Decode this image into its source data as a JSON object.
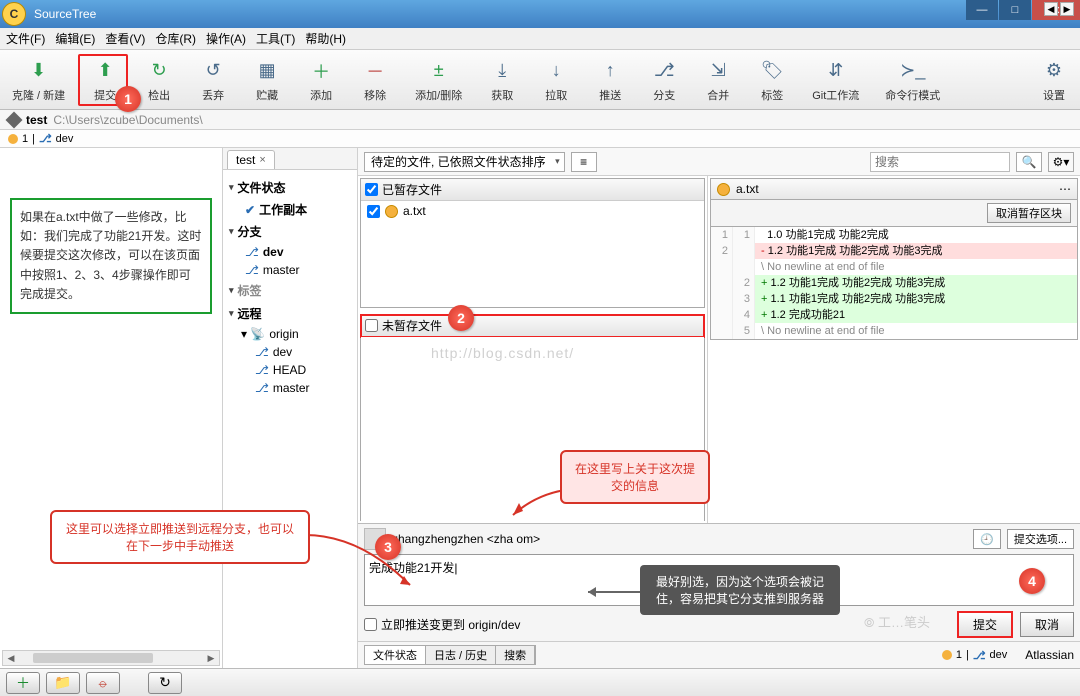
{
  "window": {
    "title": "SourceTree"
  },
  "menu": {
    "file": "文件(F)",
    "edit": "编辑(E)",
    "view": "查看(V)",
    "repo": "仓库(R)",
    "action": "操作(A)",
    "tool": "工具(T)",
    "help": "帮助(H)"
  },
  "toolbar": {
    "clone": "克隆 / 新建",
    "commit": "提交",
    "checkout": "检出",
    "discard": "丢弃",
    "stash": "贮藏",
    "add": "添加",
    "remove": "移除",
    "addremove": "添加/删除",
    "fetch": "获取",
    "pull": "拉取",
    "push": "推送",
    "branch": "分支",
    "merge": "合并",
    "tag": "标签",
    "gitflow": "Git工作流",
    "terminal": "命令行模式",
    "settings": "设置"
  },
  "repo": {
    "name": "test",
    "path": "C:\\Users\\zcube\\Documents\\",
    "behind": "1",
    "branch": "dev"
  },
  "tabs": {
    "test": "test"
  },
  "tree": {
    "filestate": "文件状态",
    "workcopy": "工作副本",
    "branches": "分支",
    "dev": "dev",
    "master": "master",
    "tags": "标签",
    "remotes": "远程",
    "origin": "origin",
    "rdev": "dev",
    "rhead": "HEAD",
    "rmaster": "master"
  },
  "filters": {
    "pending": "待定的文件, 已依照文件状态排序",
    "view": "≡",
    "search_ph": "搜索"
  },
  "stage": {
    "staged": "已暂存文件",
    "unstaged": "未暂存文件",
    "file": "a.txt"
  },
  "diff": {
    "filename": "a.txt",
    "revert": "取消暂存区块",
    "lines": [
      {
        "o": "1",
        "n": "1",
        "t": "ctx",
        "c": "1.0 功能1完成 功能2完成"
      },
      {
        "o": "2",
        "n": "",
        "t": "del",
        "c": "1.2 功能1完成 功能2完成 功能3完成"
      },
      {
        "o": "",
        "n": "",
        "t": "meta",
        "c": "No newline at end of file"
      },
      {
        "o": "",
        "n": "2",
        "t": "add",
        "c": "1.2 功能1完成 功能2完成 功能3完成"
      },
      {
        "o": "",
        "n": "3",
        "t": "add",
        "c": "1.1 功能1完成 功能2完成 功能3完成"
      },
      {
        "o": "",
        "n": "4",
        "t": "add",
        "c": "1.2 完成功能21"
      },
      {
        "o": "",
        "n": "5",
        "t": "meta",
        "c": "No newline at end of file"
      }
    ]
  },
  "commit": {
    "author": "zhangzhengzhen <zha                                          om>",
    "message": "完成功能21开发|",
    "options": "提交选项...",
    "push_immediate": "立即推送变更到 origin/dev",
    "commit_btn": "提交",
    "cancel_btn": "取消"
  },
  "bottom": {
    "tab_file": "文件状态",
    "tab_log": "日志 / 历史",
    "tab_search": "搜索",
    "atlassian": "Atlassian"
  },
  "notes": {
    "left": "如果在a.txt中做了一些修改，比如：我们完成了功能21开发。这时候要提交这次修改，可以在该页面中按照1、2、3、4步骤操作即可完成提交。",
    "push": "这里可以选择立即推送到远程分支，也可以在下一步中手动推送",
    "msg": "在这里写上关于这次提交的信息",
    "warn": "最好别选，因为这个选项会被记住，容易把其它分支推到服务器"
  },
  "watermark": "http://blog.csdn.net/"
}
